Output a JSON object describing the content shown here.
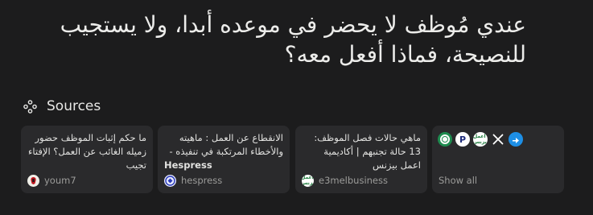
{
  "question": {
    "text": "عندي مُوظف لا يحضر في موعده أبدا، ولا يستجيب للنصيحة، فماذا أفعل معه؟"
  },
  "sources": {
    "title": "Sources",
    "show_all_label": "Show all",
    "cards": [
      {
        "title": "ما حكم إثبات الموظف حضور زميله الغائب عن العمل؟ الإفتاء تجيب",
        "title_strong": "",
        "domain": "youm7",
        "icon": "youm7-favicon"
      },
      {
        "title": "الانقطاع عن العمل : ماهيته والأخطاء المرتكبة في تنفيذه -",
        "title_strong": "Hespress",
        "domain": "hespress",
        "icon": "hespress-favicon"
      },
      {
        "title": "ماهي حالات فصل الموظف: 13 حالة تجنبهم | أكاديمية اعمل بيزنس",
        "title_strong": "",
        "domain": "e3melbusiness",
        "icon": "e3melbusiness-favicon"
      }
    ],
    "more_icons": [
      "green-circle-icon",
      "p-badge-icon",
      "e3mel-icon",
      "x-icon",
      "blue-arrow-icon"
    ],
    "e3mel_badge_text": "اعمل بزنس",
    "p_badge_text": "P"
  }
}
